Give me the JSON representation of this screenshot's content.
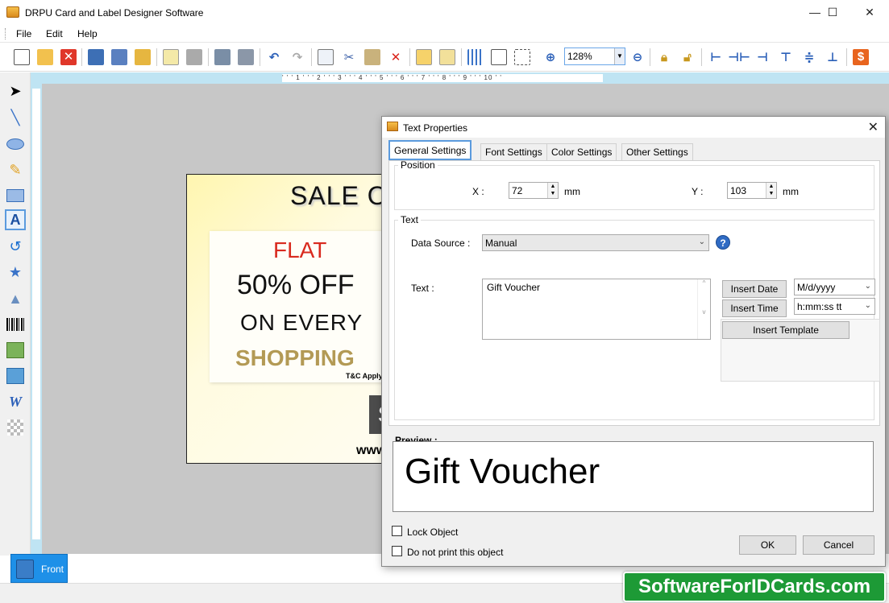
{
  "window": {
    "title": "DRPU Card and Label Designer Software",
    "min": "—",
    "max": "☐",
    "close": "✕"
  },
  "menu": {
    "file": "File",
    "edit": "Edit",
    "help": "Help"
  },
  "toolbar": {
    "zoom": "128%"
  },
  "ruler": {
    "h_labels": "' ' ' 1 ' ' ' 2 ' ' ' 3 ' ' ' 4 ' ' ' 5 ' ' ' 6 ' ' ' 7 ' ' ' 8 ' ' ' 9 ' ' ' 10 ' '"
  },
  "card": {
    "title": "SALE OFFER",
    "flat": "FLAT",
    "off": "50% OFF",
    "every": "ON EVERY",
    "shopping": "SHOPPING",
    "tc": "T&C Apply",
    "dark_letter": "S",
    "www": "www"
  },
  "pages": {
    "front": "Front"
  },
  "dialog": {
    "title": "Text Properties",
    "close": "✕",
    "tabs": [
      "General Settings",
      "Font Settings",
      "Color Settings",
      "Other Settings"
    ],
    "position": {
      "legend": "Position",
      "x_label": "X :",
      "x_value": "72",
      "x_unit": "mm",
      "y_label": "Y :",
      "y_value": "103",
      "y_unit": "mm"
    },
    "text": {
      "legend": "Text",
      "source_label": "Data Source :",
      "source_value": "Manual",
      "text_label": "Text :",
      "text_value": "Gift Voucher",
      "insert_date": "Insert Date",
      "date_format": "M/d/yyyy",
      "insert_time": "Insert Time",
      "time_format": "h:mm:ss tt",
      "insert_template": "Insert Template"
    },
    "preview": {
      "label": "Preview :",
      "text": "Gift Voucher"
    },
    "lock": "Lock Object",
    "no_print": "Do not print this object",
    "ok": "OK",
    "cancel": "Cancel"
  },
  "watermark": "SoftwareForIDCards.com",
  "colors": {
    "accent": "#1e90e8",
    "watermark": "#1d9a36",
    "ruler": "#bfe4f3",
    "sale_red": "#d92a1f",
    "shopping_gold": "#b39a55"
  }
}
